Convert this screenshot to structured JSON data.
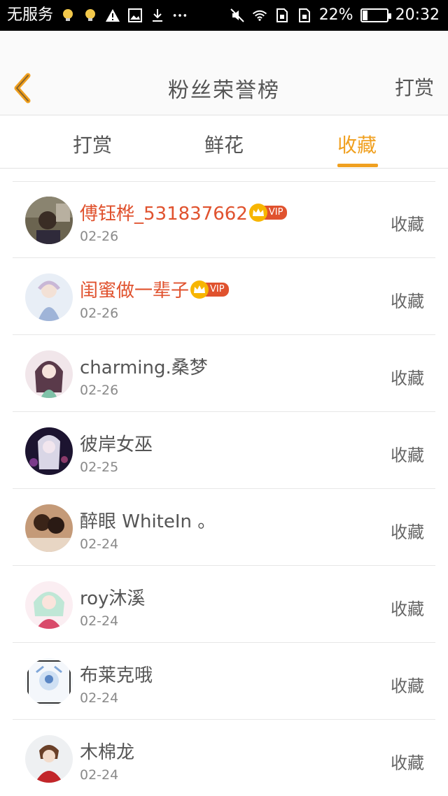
{
  "status_bar": {
    "carrier": "无服务",
    "battery_percent": "22%",
    "time": "20:32",
    "battery_level": 0.22,
    "left_icons": [
      "bulb-icon",
      "bulb-icon",
      "warning-icon",
      "image-icon",
      "download-icon",
      "more-icon"
    ],
    "right_icons": [
      "mute-icon",
      "wifi-icon",
      "sim-icon",
      "sim-icon"
    ]
  },
  "app_bar": {
    "title": "粉丝荣誉榜",
    "right_action": "打赏",
    "back_icon": "chevron-left-icon",
    "accent_color": "#f0a020"
  },
  "tabs": [
    {
      "label": "打赏",
      "active": false
    },
    {
      "label": "鲜花",
      "active": false
    },
    {
      "label": "收藏",
      "active": true
    }
  ],
  "colors": {
    "vip_name": "#e0522e",
    "accent": "#f0a020",
    "crown": "#f7b500"
  },
  "fans": [
    {
      "name": "傅钰桦_531837662",
      "date": "02-26",
      "action": "收藏",
      "vip": true,
      "vip_label": "VIP"
    },
    {
      "name": "闺蜜做一辈子",
      "date": "02-26",
      "action": "收藏",
      "vip": true,
      "vip_label": "VIP"
    },
    {
      "name": "charming.桑梦",
      "date": "02-26",
      "action": "收藏",
      "vip": false
    },
    {
      "name": "彼岸女巫",
      "date": "02-25",
      "action": "收藏",
      "vip": false
    },
    {
      "name": "醉眼 WhiteIn 。",
      "date": "02-24",
      "action": "收藏",
      "vip": false
    },
    {
      "name": "roy沐溪",
      "date": "02-24",
      "action": "收藏",
      "vip": false
    },
    {
      "name": "布莱克哦",
      "date": "02-24",
      "action": "收藏",
      "vip": false
    },
    {
      "name": "木棉龙",
      "date": "02-24",
      "action": "收藏",
      "vip": false
    }
  ]
}
